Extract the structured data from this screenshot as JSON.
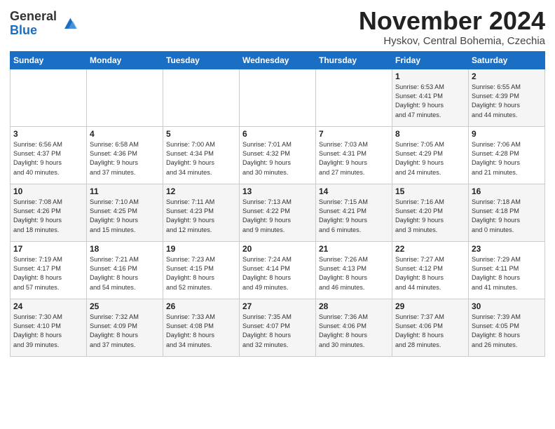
{
  "logo": {
    "general": "General",
    "blue": "Blue"
  },
  "title": "November 2024",
  "location": "Hyskov, Central Bohemia, Czechia",
  "days_header": [
    "Sunday",
    "Monday",
    "Tuesday",
    "Wednesday",
    "Thursday",
    "Friday",
    "Saturday"
  ],
  "weeks": [
    [
      {
        "day": "",
        "info": ""
      },
      {
        "day": "",
        "info": ""
      },
      {
        "day": "",
        "info": ""
      },
      {
        "day": "",
        "info": ""
      },
      {
        "day": "",
        "info": ""
      },
      {
        "day": "1",
        "info": "Sunrise: 6:53 AM\nSunset: 4:41 PM\nDaylight: 9 hours\nand 47 minutes."
      },
      {
        "day": "2",
        "info": "Sunrise: 6:55 AM\nSunset: 4:39 PM\nDaylight: 9 hours\nand 44 minutes."
      }
    ],
    [
      {
        "day": "3",
        "info": "Sunrise: 6:56 AM\nSunset: 4:37 PM\nDaylight: 9 hours\nand 40 minutes."
      },
      {
        "day": "4",
        "info": "Sunrise: 6:58 AM\nSunset: 4:36 PM\nDaylight: 9 hours\nand 37 minutes."
      },
      {
        "day": "5",
        "info": "Sunrise: 7:00 AM\nSunset: 4:34 PM\nDaylight: 9 hours\nand 34 minutes."
      },
      {
        "day": "6",
        "info": "Sunrise: 7:01 AM\nSunset: 4:32 PM\nDaylight: 9 hours\nand 30 minutes."
      },
      {
        "day": "7",
        "info": "Sunrise: 7:03 AM\nSunset: 4:31 PM\nDaylight: 9 hours\nand 27 minutes."
      },
      {
        "day": "8",
        "info": "Sunrise: 7:05 AM\nSunset: 4:29 PM\nDaylight: 9 hours\nand 24 minutes."
      },
      {
        "day": "9",
        "info": "Sunrise: 7:06 AM\nSunset: 4:28 PM\nDaylight: 9 hours\nand 21 minutes."
      }
    ],
    [
      {
        "day": "10",
        "info": "Sunrise: 7:08 AM\nSunset: 4:26 PM\nDaylight: 9 hours\nand 18 minutes."
      },
      {
        "day": "11",
        "info": "Sunrise: 7:10 AM\nSunset: 4:25 PM\nDaylight: 9 hours\nand 15 minutes."
      },
      {
        "day": "12",
        "info": "Sunrise: 7:11 AM\nSunset: 4:23 PM\nDaylight: 9 hours\nand 12 minutes."
      },
      {
        "day": "13",
        "info": "Sunrise: 7:13 AM\nSunset: 4:22 PM\nDaylight: 9 hours\nand 9 minutes."
      },
      {
        "day": "14",
        "info": "Sunrise: 7:15 AM\nSunset: 4:21 PM\nDaylight: 9 hours\nand 6 minutes."
      },
      {
        "day": "15",
        "info": "Sunrise: 7:16 AM\nSunset: 4:20 PM\nDaylight: 9 hours\nand 3 minutes."
      },
      {
        "day": "16",
        "info": "Sunrise: 7:18 AM\nSunset: 4:18 PM\nDaylight: 9 hours\nand 0 minutes."
      }
    ],
    [
      {
        "day": "17",
        "info": "Sunrise: 7:19 AM\nSunset: 4:17 PM\nDaylight: 8 hours\nand 57 minutes."
      },
      {
        "day": "18",
        "info": "Sunrise: 7:21 AM\nSunset: 4:16 PM\nDaylight: 8 hours\nand 54 minutes."
      },
      {
        "day": "19",
        "info": "Sunrise: 7:23 AM\nSunset: 4:15 PM\nDaylight: 8 hours\nand 52 minutes."
      },
      {
        "day": "20",
        "info": "Sunrise: 7:24 AM\nSunset: 4:14 PM\nDaylight: 8 hours\nand 49 minutes."
      },
      {
        "day": "21",
        "info": "Sunrise: 7:26 AM\nSunset: 4:13 PM\nDaylight: 8 hours\nand 46 minutes."
      },
      {
        "day": "22",
        "info": "Sunrise: 7:27 AM\nSunset: 4:12 PM\nDaylight: 8 hours\nand 44 minutes."
      },
      {
        "day": "23",
        "info": "Sunrise: 7:29 AM\nSunset: 4:11 PM\nDaylight: 8 hours\nand 41 minutes."
      }
    ],
    [
      {
        "day": "24",
        "info": "Sunrise: 7:30 AM\nSunset: 4:10 PM\nDaylight: 8 hours\nand 39 minutes."
      },
      {
        "day": "25",
        "info": "Sunrise: 7:32 AM\nSunset: 4:09 PM\nDaylight: 8 hours\nand 37 minutes."
      },
      {
        "day": "26",
        "info": "Sunrise: 7:33 AM\nSunset: 4:08 PM\nDaylight: 8 hours\nand 34 minutes."
      },
      {
        "day": "27",
        "info": "Sunrise: 7:35 AM\nSunset: 4:07 PM\nDaylight: 8 hours\nand 32 minutes."
      },
      {
        "day": "28",
        "info": "Sunrise: 7:36 AM\nSunset: 4:06 PM\nDaylight: 8 hours\nand 30 minutes."
      },
      {
        "day": "29",
        "info": "Sunrise: 7:37 AM\nSunset: 4:06 PM\nDaylight: 8 hours\nand 28 minutes."
      },
      {
        "day": "30",
        "info": "Sunrise: 7:39 AM\nSunset: 4:05 PM\nDaylight: 8 hours\nand 26 minutes."
      }
    ]
  ]
}
